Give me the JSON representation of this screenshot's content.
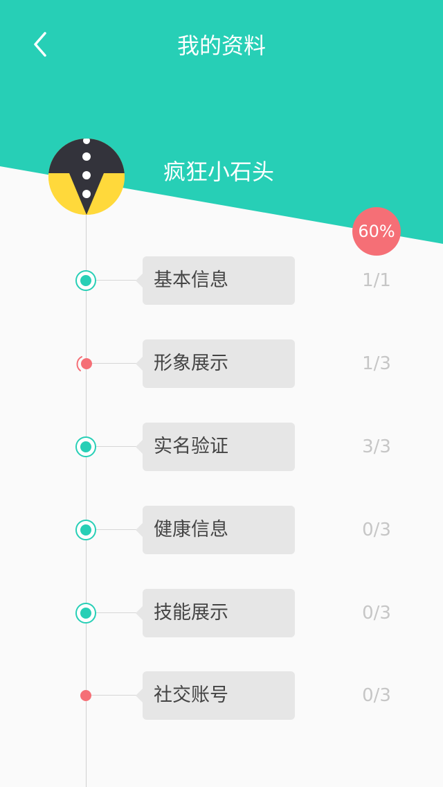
{
  "colors": {
    "header": "#27cfb6",
    "background": "#fafafa",
    "badge": "#f56f76",
    "node_complete": "#27cfb6",
    "node_incomplete": "#f56f76",
    "card": "#e6e6e6",
    "count_text": "#c6c6c6"
  },
  "header": {
    "title": "我的资料",
    "back_icon": "chevron-left-icon"
  },
  "profile": {
    "username": "疯狂小石头",
    "avatar_icon": "tuxedo-avatar-icon",
    "progress_label": "60%",
    "progress_value": 0.6
  },
  "sections": [
    {
      "label": "基本信息",
      "count": "1/1",
      "status": "complete"
    },
    {
      "label": "形象展示",
      "count": "1/3",
      "status": "in-progress"
    },
    {
      "label": "实名验证",
      "count": "3/3",
      "status": "complete"
    },
    {
      "label": "健康信息",
      "count": "0/3",
      "status": "complete"
    },
    {
      "label": "技能展示",
      "count": "0/3",
      "status": "complete"
    },
    {
      "label": "社交账号",
      "count": "0/3",
      "status": "incomplete"
    }
  ]
}
